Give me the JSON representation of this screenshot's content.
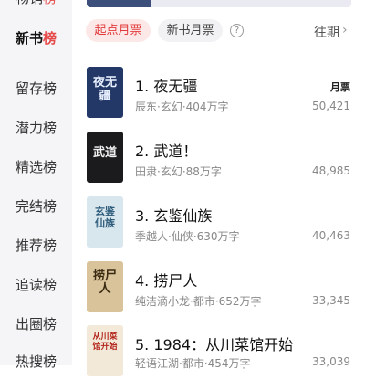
{
  "sidebar": {
    "partial_top": {
      "prefix": "畅销",
      "highlight": "榜"
    },
    "active": {
      "prefix": "新书",
      "highlight": "榜"
    },
    "items": [
      {
        "label": "留存榜"
      },
      {
        "label": "潜力榜"
      },
      {
        "label": "精选榜"
      },
      {
        "label": "完结榜"
      },
      {
        "label": "推荐榜"
      },
      {
        "label": "追读榜"
      },
      {
        "label": "出圈榜"
      }
    ],
    "partial_bottom": "热搜榜"
  },
  "filters": {
    "tabs": [
      "起点月票",
      "新书月票"
    ],
    "past_label": "往期",
    "help_symbol": "?",
    "chevron": "›"
  },
  "list": {
    "vote_label": "月票",
    "books": [
      {
        "title": "1. 夜无疆",
        "meta": "辰东·玄幻·404万字",
        "votes": "50,421",
        "cover_text": "夜无疆",
        "cover_bg": "#233867"
      },
      {
        "title": "2. 武道！",
        "meta": "田隶·玄幻·88万字",
        "votes": "48,985",
        "cover_text": "武道",
        "cover_bg": "#1b1b1d"
      },
      {
        "title": "3. 玄鉴仙族",
        "meta": "季越人·仙侠·630万字",
        "votes": "40,463",
        "cover_text": "玄鉴仙族",
        "cover_bg": "#d8e6ee"
      },
      {
        "title": "4. 捞尸人",
        "meta": "纯洁滴小龙·都市·652万字",
        "votes": "33,345",
        "cover_text": "捞尸人",
        "cover_bg": "#d8c39a"
      },
      {
        "title": "5. 1984：从川菜馆开始",
        "meta": "轻语江湖·都市·454万字",
        "votes": "33,039",
        "cover_text": "从川菜馆开始",
        "cover_bg": "#f3e9d8"
      }
    ]
  },
  "colors": {
    "accent": "#e23b3b",
    "sidebar_bg": "#f5f5f7"
  }
}
